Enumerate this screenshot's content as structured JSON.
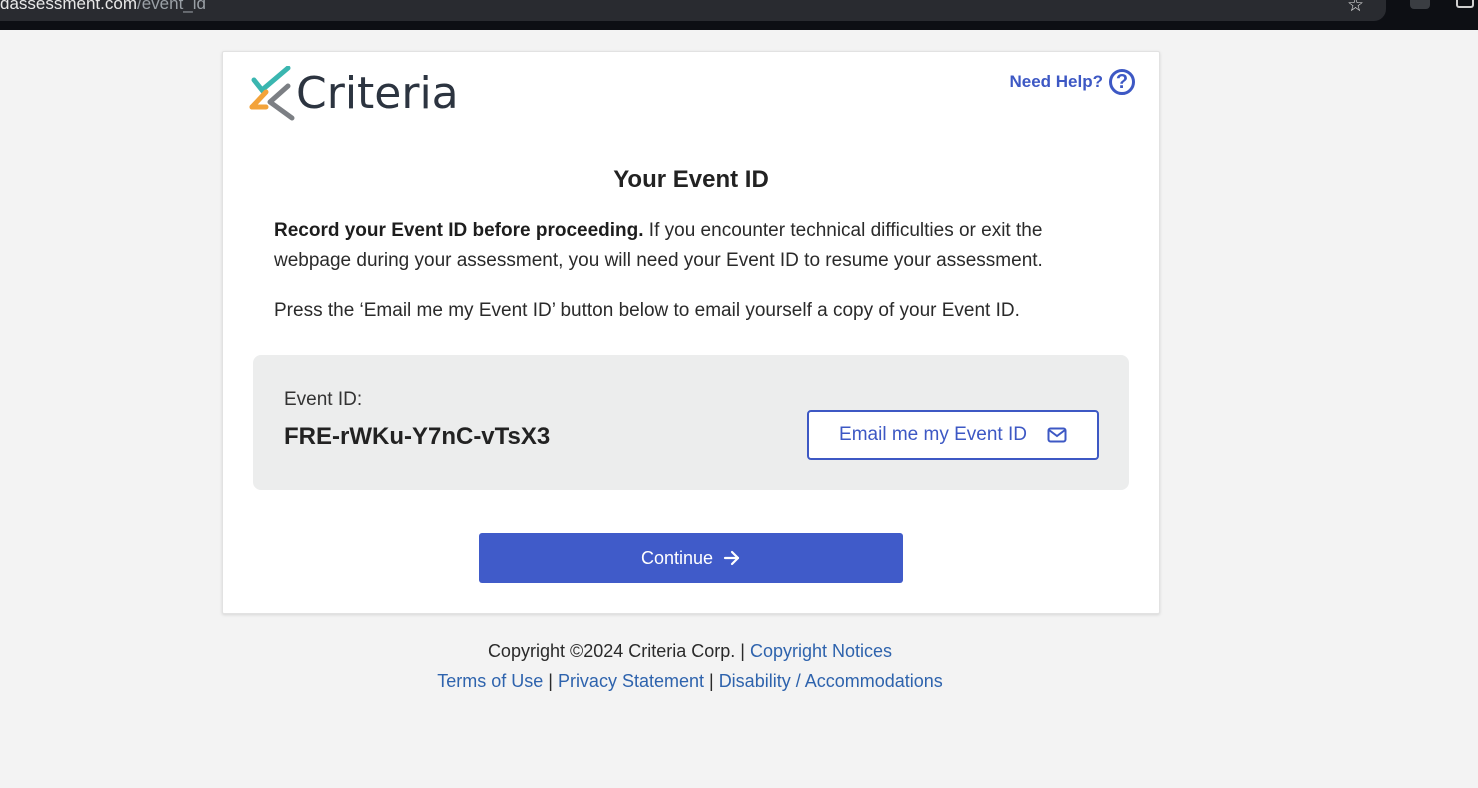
{
  "browser": {
    "url_domain": "dassessment.com",
    "url_path": "/event_id"
  },
  "card": {
    "logo_text": "Criteria",
    "help_label": "Need Help?",
    "title": "Your Event ID",
    "instruction_bold": "Record your Event ID before proceeding.",
    "instruction_rest": " If you encounter technical difficulties or exit the webpage during your assessment, you will need your Event ID to resume your assessment.",
    "email_instruction": "Press the ‘Email me my Event ID’ button below to email yourself a copy of your Event ID.",
    "event_id_label": "Event ID:",
    "event_id_value": "FRE-rWKu-Y7nC-vTsX3",
    "email_button_label": "Email me my Event ID",
    "continue_label": "Continue"
  },
  "footer": {
    "copyright": "Copyright ©2024 Criteria Corp. | ",
    "copyright_link": "Copyright Notices",
    "terms": "Terms of Use",
    "sep": " | ",
    "privacy": "Privacy Statement",
    "disability": "Disability / Accommodations"
  },
  "colors": {
    "accent": "#405bc9",
    "link": "#2e63ad",
    "logo_teal": "#3ab6b0",
    "logo_orange": "#f3a33a",
    "logo_grey": "#7c7f84"
  }
}
